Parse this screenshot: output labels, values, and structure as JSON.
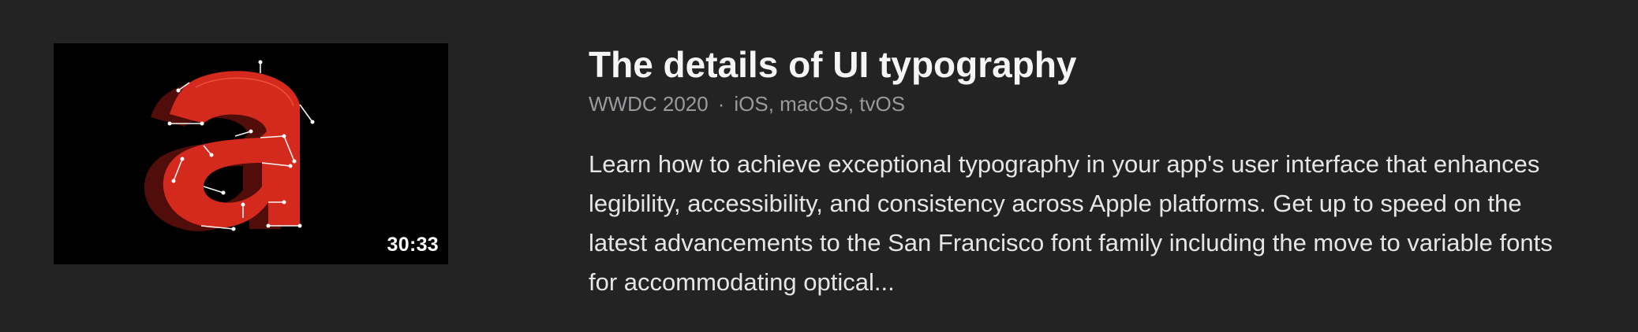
{
  "session": {
    "title": "The details of UI typography",
    "event": "WWDC 2020",
    "separator": "·",
    "platforms": "iOS, macOS, tvOS",
    "description": "Learn how to achieve exceptional typography in your app's user interface that enhances legibility, accessibility, and consistency across Apple platforms. Get up to speed on the latest advancements to the San Francisco font family including the move to variable fonts for accommodating optical...",
    "duration": "30:33",
    "thumbnail": {
      "glyph": "a",
      "glyph_color": "#d42a1e",
      "background": "#000000"
    }
  }
}
